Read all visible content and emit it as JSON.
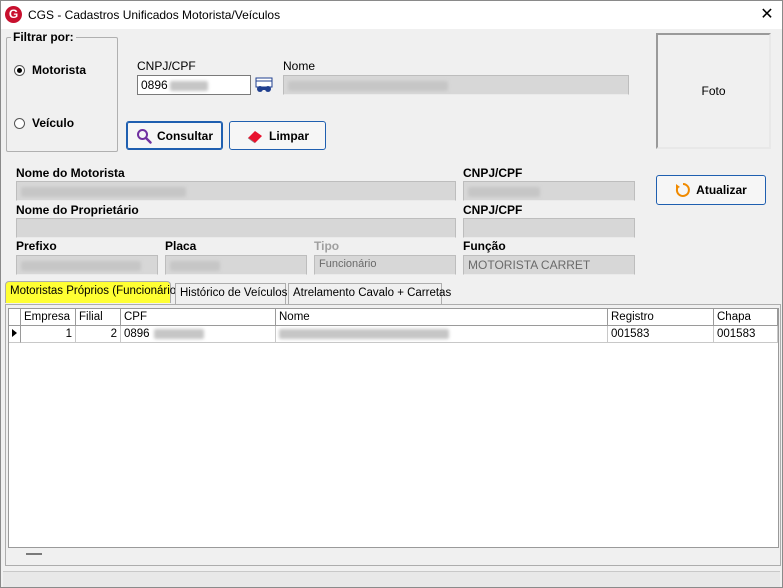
{
  "window": {
    "title": "CGS - Cadastros Unificados Motorista/Veículos",
    "close_glyph": "✕"
  },
  "filter": {
    "legend": "Filtrar por:",
    "options": [
      {
        "label": "Motorista",
        "checked": true
      },
      {
        "label": "Veículo",
        "checked": false
      }
    ]
  },
  "search": {
    "cnpj_label": "CNPJ/CPF",
    "cnpj_value": "0896",
    "name_label": "Nome",
    "name_value": "",
    "consultar_label": "Consultar",
    "limpar_label": "Limpar"
  },
  "photo": {
    "label": "Foto"
  },
  "details": {
    "nome_motorista_label": "Nome do Motorista",
    "nome_motorista_value": "",
    "cnpj_motorista_label": "CNPJ/CPF",
    "cnpj_motorista_value": "",
    "nome_proprietario_label": "Nome do Proprietário",
    "nome_proprietario_value": "",
    "cnpj_proprietario_label": "CNPJ/CPF",
    "cnpj_proprietario_value": "",
    "prefixo_label": "Prefixo",
    "prefixo_value": "",
    "placa_label": "Placa",
    "placa_value": "",
    "tipo_label": "Tipo",
    "tipo_value": "Funcionário",
    "funcao_label": "Função",
    "funcao_value": "MOTORISTA CARRET",
    "atualizar_label": "Atualizar"
  },
  "tabs": [
    {
      "label": "Motoristas Próprios (Funcionários)",
      "active": true
    },
    {
      "label": "Histórico de Veículos",
      "active": false
    },
    {
      "label": "Atrelamento Cavalo + Carretas",
      "active": false
    }
  ],
  "grid": {
    "columns": [
      "Empresa",
      "Filial",
      "CPF",
      "Nome",
      "Registro",
      "Chapa"
    ],
    "rows": [
      {
        "empresa": "1",
        "filial": "2",
        "cpf": "0896",
        "nome": "",
        "registro": "001583",
        "chapa": "001583"
      }
    ]
  },
  "colors": {
    "accent": "#1f5fb0",
    "tab_highlight": "#ffff33",
    "logo": "#c8102e"
  }
}
